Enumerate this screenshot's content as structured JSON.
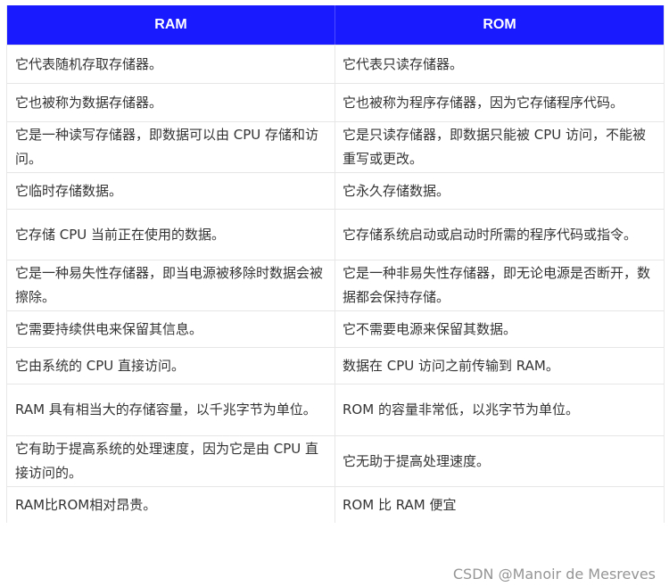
{
  "table": {
    "headers": [
      "RAM",
      "ROM"
    ],
    "rows": [
      [
        "它代表随机存取存储器。",
        "它代表只读存储器。"
      ],
      [
        "它也被称为数据存储器。",
        "它也被称为程序存储器，因为它存储程序代码。"
      ],
      [
        "它是一种读写存储器，即数据可以由 CPU 存储和访问。",
        "它是只读存储器，即数据只能被 CPU 访问，不能被重写或更改。"
      ],
      [
        "它临时存储数据。",
        "它永久存储数据。"
      ],
      [
        "它存储 CPU 当前正在使用的数据。",
        "它存储系统启动或启动时所需的程序代码或指令。"
      ],
      [
        "它是一种易失性存储器，即当电源被移除时数据会被擦除。",
        "它是一种非易失性存储器，即无论电源是否断开，数据都会保持存储。"
      ],
      [
        "它需要持续供电来保留其信息。",
        "它不需要电源来保留其数据。"
      ],
      [
        "它由系统的 CPU 直接访问。",
        "数据在 CPU 访问之前传输到 RAM。"
      ],
      [
        "RAM 具有相当大的存储容量，以千兆字节为单位。",
        "ROM 的容量非常低，以兆字节为单位。"
      ],
      [
        "它有助于提高系统的处理速度，因为它是由 CPU 直接访问的。",
        "它无助于提高处理速度。"
      ],
      [
        "RAM比ROM相对昂贵。",
        "ROM 比 RAM 便宜"
      ]
    ]
  },
  "watermark": "CSDN @Manoir de Mesreves",
  "colors": {
    "header_bg": "#1a1aff",
    "header_text": "#ffffff",
    "body_text": "#333333",
    "border": "#e6e6e6"
  }
}
